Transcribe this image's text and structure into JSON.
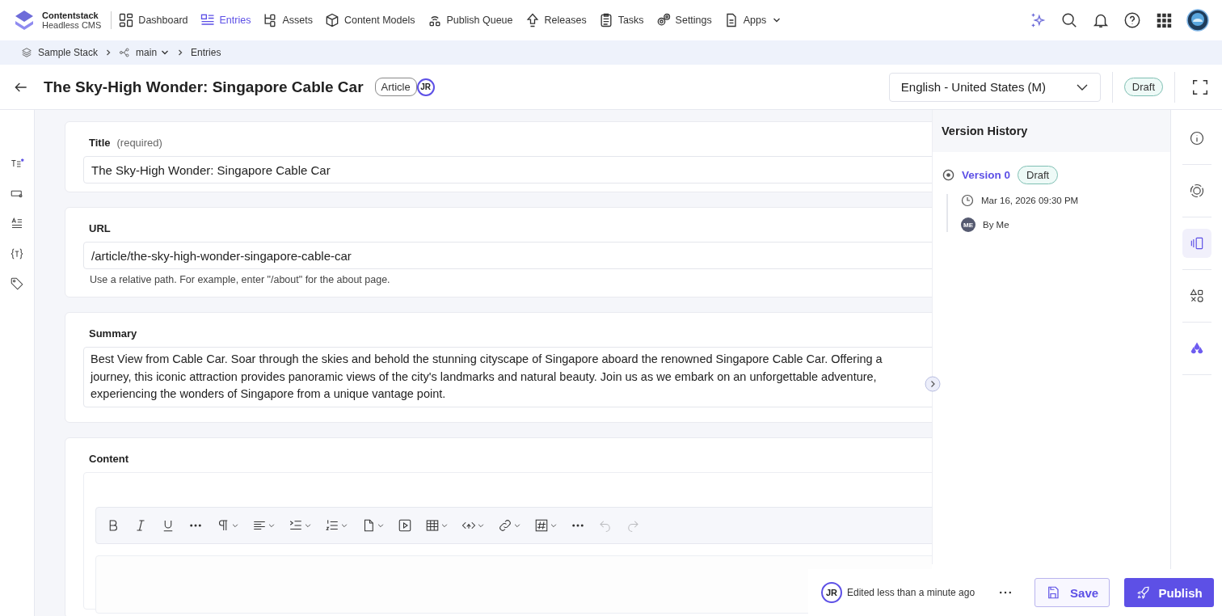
{
  "app": {
    "name": "Contentstack",
    "subtitle": "Headless CMS"
  },
  "nav": [
    {
      "label": "Dashboard",
      "selected": false
    },
    {
      "label": "Entries",
      "selected": true
    },
    {
      "label": "Assets",
      "selected": false
    },
    {
      "label": "Content Models",
      "selected": false
    },
    {
      "label": "Publish Queue",
      "selected": false
    },
    {
      "label": "Releases",
      "selected": false
    },
    {
      "label": "Tasks",
      "selected": false
    },
    {
      "label": "Settings",
      "selected": false
    },
    {
      "label": "Apps",
      "selected": false
    }
  ],
  "breadcrumb": {
    "stack": "Sample Stack",
    "branch": "main",
    "page": "Entries"
  },
  "entry": {
    "title": "The Sky-High Wonder: Singapore Cable Car",
    "content_type": "Article",
    "user_initials": "JR",
    "locale": "English - United States (M)",
    "status": "Draft"
  },
  "fields": [
    {
      "kind": "text",
      "label": "Title",
      "note": "(required)",
      "value": "The Sky-High Wonder: Singapore Cable Car"
    },
    {
      "kind": "text",
      "label": "URL",
      "value": "/article/the-sky-high-wonder-singapore-cable-car",
      "help": "Use a relative path. For example, enter \"/about\" for the about page."
    },
    {
      "kind": "multiline",
      "label": "Summary",
      "lines": [
        "Best View from Cable Car. Soar through the skies and behold the stunning cityscape of Singapore aboard the renowned Singapore Cable Car. Offering a",
        "journey, this iconic attraction provides panoramic views of the city's landmarks and natural beauty. Join us as we embark on an unforgettable adventure,",
        "experiencing the wonders of Singapore from a unique vantage point."
      ]
    },
    {
      "kind": "rich",
      "label": "Content"
    }
  ],
  "editor_toolbar": {
    "undo_disabled": true,
    "redo_disabled": true
  },
  "version_history": {
    "title": "Version History",
    "versions": [
      {
        "name": "Version 0",
        "status": "Draft",
        "date": "Mar 16, 2026 09:30 PM",
        "author_initials": "ME",
        "author": "By Me"
      }
    ]
  },
  "right_rail": [
    {
      "selected": false
    },
    {
      "selected": false
    },
    {
      "selected": true
    },
    {
      "selected": false
    },
    {
      "selected": false
    }
  ],
  "footer": {
    "editor_initials": "JR",
    "edited": "Edited less than a minute ago",
    "save": "Save",
    "publish": "Publish"
  }
}
